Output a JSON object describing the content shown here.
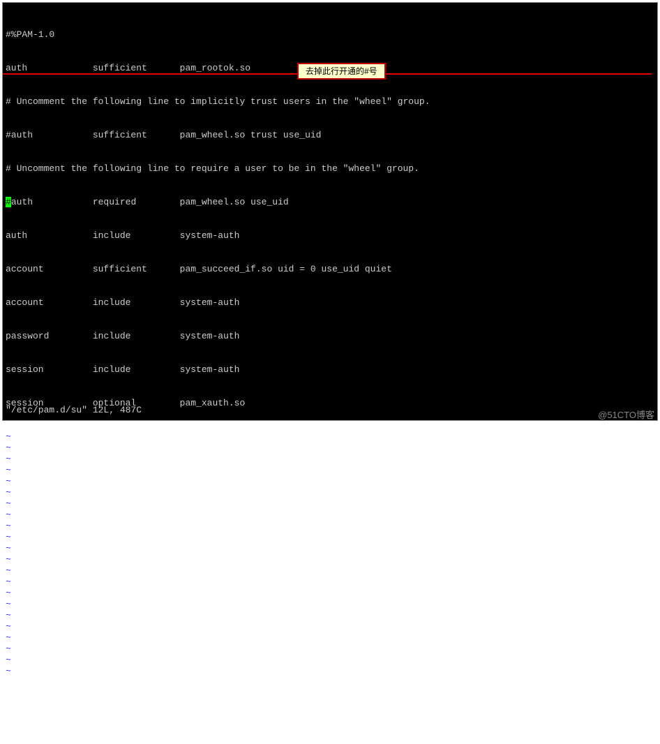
{
  "terminal": {
    "lines": [
      "#%PAM-1.0",
      "auth            sufficient      pam_rootok.so",
      "# Uncomment the following line to implicitly trust users in the \"wheel\" group.",
      "#auth           sufficient      pam_wheel.so trust use_uid",
      "# Uncomment the following line to require a user to be in the \"wheel\" group."
    ],
    "highlight_line": {
      "cursor_char": "#",
      "rest": "auth           required        pam_wheel.so use_uid"
    },
    "lines_after": [
      "auth            include         system-auth",
      "account         sufficient      pam_succeed_if.so uid = 0 use_uid quiet",
      "account         include         system-auth",
      "password        include         system-auth",
      "session         include         system-auth",
      "session         optional        pam_xauth.so"
    ],
    "tilde": "~",
    "tilde_count": 22,
    "status": "\"/etc/pam.d/su\" 12L, 487C"
  },
  "annotation": {
    "text": "去掉此行开通的#号"
  },
  "watermark": {
    "text": "@51CTO博客"
  }
}
